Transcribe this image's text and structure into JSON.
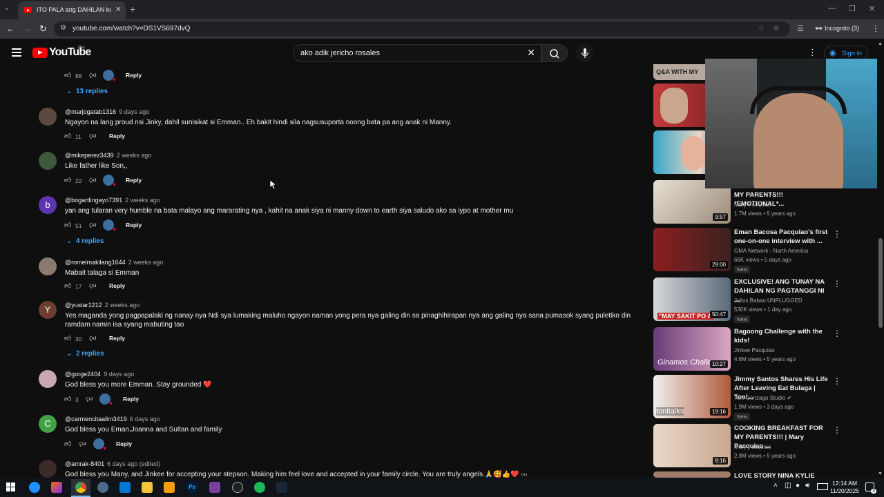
{
  "browser": {
    "tab_title": "ITO PALA ang DAHILAN kung B",
    "url": "youtube.com/watch?v=DS1VS697dvQ",
    "incognito_label": "Incognito (3)"
  },
  "youtube": {
    "logo_text": "YouTube",
    "country": "PH",
    "search_query": "ako adik jericho rosales",
    "signin_label": "Sign in"
  },
  "comments": [
    {
      "handle": "",
      "time": "",
      "text": "",
      "likes": "88",
      "reply_label": "Reply",
      "replies": "13 replies"
    },
    {
      "handle": "@marjogatab1316",
      "time": "9 days ago",
      "text": "Ngayon na lang proud nsi Jinky, dahil sunisikat si Emman.. Eh bakit hindi sila nagsusuporta noong bata pa ang anak ni Manny.",
      "likes": "11",
      "reply_label": "Reply"
    },
    {
      "handle": "@mikeperez3439",
      "time": "2 weeks ago",
      "text": "Like father like Son,,",
      "likes": "22",
      "reply_label": "Reply"
    },
    {
      "handle": "@bogartlingayo7391",
      "time": "2 weeks ago",
      "text": "yan ang tularan very humble na bata malayo ang mararating nya , kahit na anak siya ni manny down to earth siya saludo ako sa iypo  at mother mu",
      "likes": "51",
      "reply_label": "Reply",
      "replies": "4 replies",
      "avatar_letter": "b"
    },
    {
      "handle": "@romelmakilang1644",
      "time": "2 weeks ago",
      "text": "Mabait talaga si Emman",
      "likes": "17",
      "reply_label": "Reply"
    },
    {
      "handle": "@yustar1212",
      "time": "2 weeks ago",
      "text": "Yes maganda yong pagpapalaki ng nanay nya Ndi sya lumaking maluho ngayon naman yong pera nya galing din sa pinaghihirapan nya ang galing nya sana pumasok syang puletiko din ramdam namin isa syang mabuting tao",
      "likes": "30",
      "reply_label": "Reply",
      "replies": "2 replies",
      "avatar_letter": "Y"
    },
    {
      "handle": "@gorge2404",
      "time": "9 days ago",
      "text": "God bless you more Emman. Stay grounded ❤️",
      "likes": "3",
      "reply_label": "Reply"
    },
    {
      "handle": "@carmencitaalim3419",
      "time": "6 days ago",
      "text": "God bless you Eman,Joanna and Sultan  and family",
      "likes": "",
      "reply_label": "Reply",
      "avatar_letter": "C"
    },
    {
      "handle": "@amrak-8401",
      "time": "6 days ago (edited)",
      "text": "God bless you Many, and Jinkee for accepting your stepson. Making him feel love and accepted in your family circle. You are truly angels.🙏🥰👍❤️",
      "likes": "",
      "reply_label": ""
    }
  ],
  "recommendations": [
    {
      "title": "MY PARENTS!!! *EMOTIONAL*...",
      "channel": "Mary Pacquiao",
      "meta": "1.7M views • 5 years ago",
      "duration": "9:57",
      "badge": ""
    },
    {
      "title": "Eman Bacosa Pacquiao's first one-on-one interview with ...",
      "channel": "GMA Network - North America",
      "meta": "66K views • 5 days ago",
      "duration": "29:00",
      "badge": "New"
    },
    {
      "title": "EXCLUSIVE! ANG TUNAY NA DAHILAN NG PAGTANGGI NI ...",
      "channel": "Julius Babao UNPLUGGED",
      "meta": "530K views • 1 day ago",
      "duration": "50:47",
      "badge": "New",
      "thumb_text": "\"MAY SAKIT PO A"
    },
    {
      "title": "Bagoong Challenge with the kids!",
      "channel": "Jinkee Pacquiao",
      "meta": "4.8M views • 5 years ago",
      "duration": "10:27",
      "badge": "",
      "thumb_text": "Ginamos Challe"
    },
    {
      "title": "Jimmy Santos Shares His Life After Leaving Eat Bulaga | Toni...",
      "channel": "Toni Gonzaga Studio",
      "meta": "1.9M views • 3 days ago",
      "duration": "19:16",
      "badge": "New",
      "thumb_text": "tonitalks"
    },
    {
      "title": "COOKING BREAKFAST FOR MY PARENTS!!! | Mary Pacquiao ...",
      "channel": "Mary Pacquiao",
      "meta": "2.8M views • 5 years ago",
      "duration": "8:16",
      "badge": ""
    },
    {
      "title": "LOVE STORY NINA KYLIE",
      "channel": "",
      "meta": "",
      "duration": "",
      "badge": ""
    }
  ],
  "top_thumb_text": "Q&A WITH MY",
  "taskbar": {
    "time": "12:14 AM",
    "date": "11/20/2025",
    "notif_count": "3"
  }
}
